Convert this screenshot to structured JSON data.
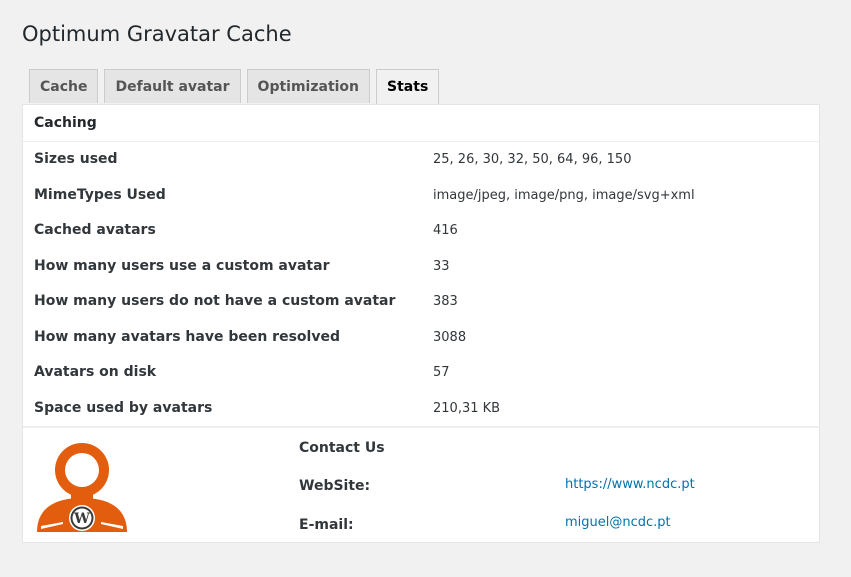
{
  "page": {
    "title": "Optimum Gravatar Cache"
  },
  "tabs": [
    {
      "label": "Cache",
      "active": false
    },
    {
      "label": "Default avatar",
      "active": false
    },
    {
      "label": "Optimization",
      "active": false
    },
    {
      "label": "Stats",
      "active": true
    }
  ],
  "section": {
    "title": "Caching"
  },
  "stats": [
    {
      "label": "Sizes used",
      "value": "25, 26, 30, 32, 50, 64, 96, 150"
    },
    {
      "label": "MimeTypes Used",
      "value": "image/jpeg, image/png, image/svg+xml"
    },
    {
      "label": "Cached avatars",
      "value": "416"
    },
    {
      "label": "How many users use a custom avatar",
      "value": "33"
    },
    {
      "label": "How many users do not have a custom avatar",
      "value": "383"
    },
    {
      "label": "How many avatars have been resolved",
      "value": "3088"
    },
    {
      "label": "Avatars on disk",
      "value": "57"
    },
    {
      "label": "Space used by avatars",
      "value": "210,31 KB"
    }
  ],
  "contact": {
    "title": "Contact Us",
    "website_label": "WebSite:",
    "website_url": "https://www.ncdc.pt",
    "email_label": "E-mail:",
    "email": "miguel@ncdc.pt"
  },
  "colors": {
    "accent": "#e25d0d",
    "link": "#0073aa"
  },
  "icons": {
    "logo": "wordpress-avatar-logo-icon"
  }
}
